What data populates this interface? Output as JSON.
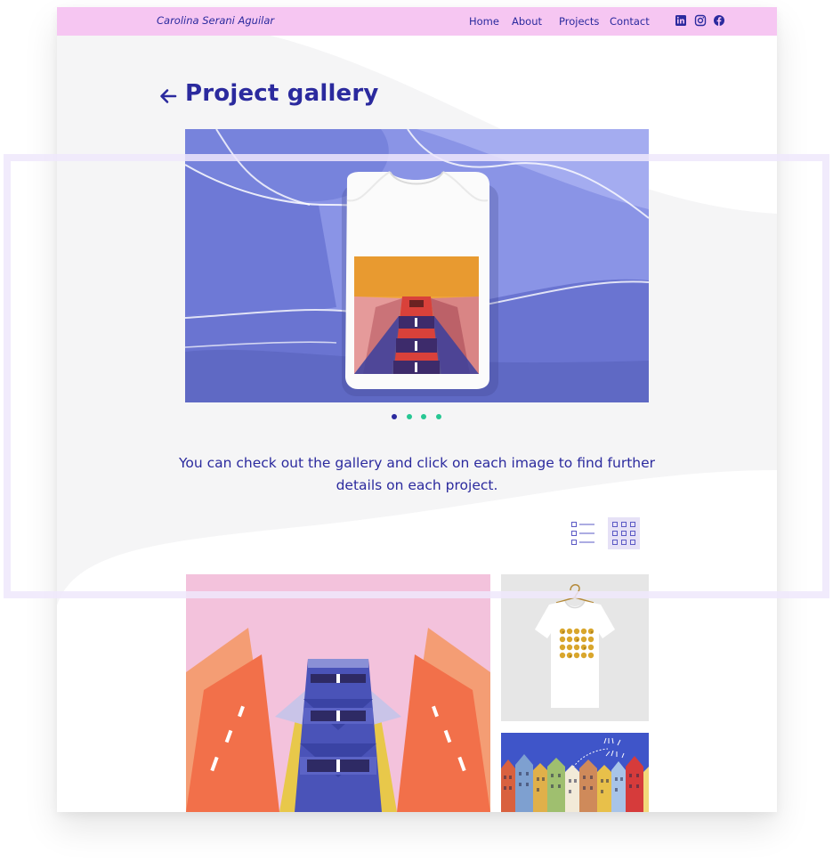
{
  "header": {
    "brand": "Carolina Serani Aguilar",
    "nav": [
      {
        "label": "Home"
      },
      {
        "label": "About"
      },
      {
        "label": "Projects"
      },
      {
        "label": "Contact"
      }
    ],
    "social_icons": [
      "linkedin-icon",
      "instagram-icon",
      "facebook-icon"
    ]
  },
  "page": {
    "title": "Project gallery",
    "back_icon": "arrow-left-icon"
  },
  "carousel": {
    "slide_count": 4,
    "active_index": 0,
    "active_color": "#2b2a9e",
    "inactive_color": "#27c793"
  },
  "intro": {
    "text": "You can check out the gallery and click on each image to find further details on each project."
  },
  "view_toggle": {
    "options": [
      "list-view-icon",
      "grid-view-icon"
    ],
    "selected": "grid-view-icon"
  },
  "colors": {
    "accent": "#2b2a9e",
    "topbar": "#f6c6f2",
    "background": "#f5f5f6",
    "green": "#27c793"
  }
}
